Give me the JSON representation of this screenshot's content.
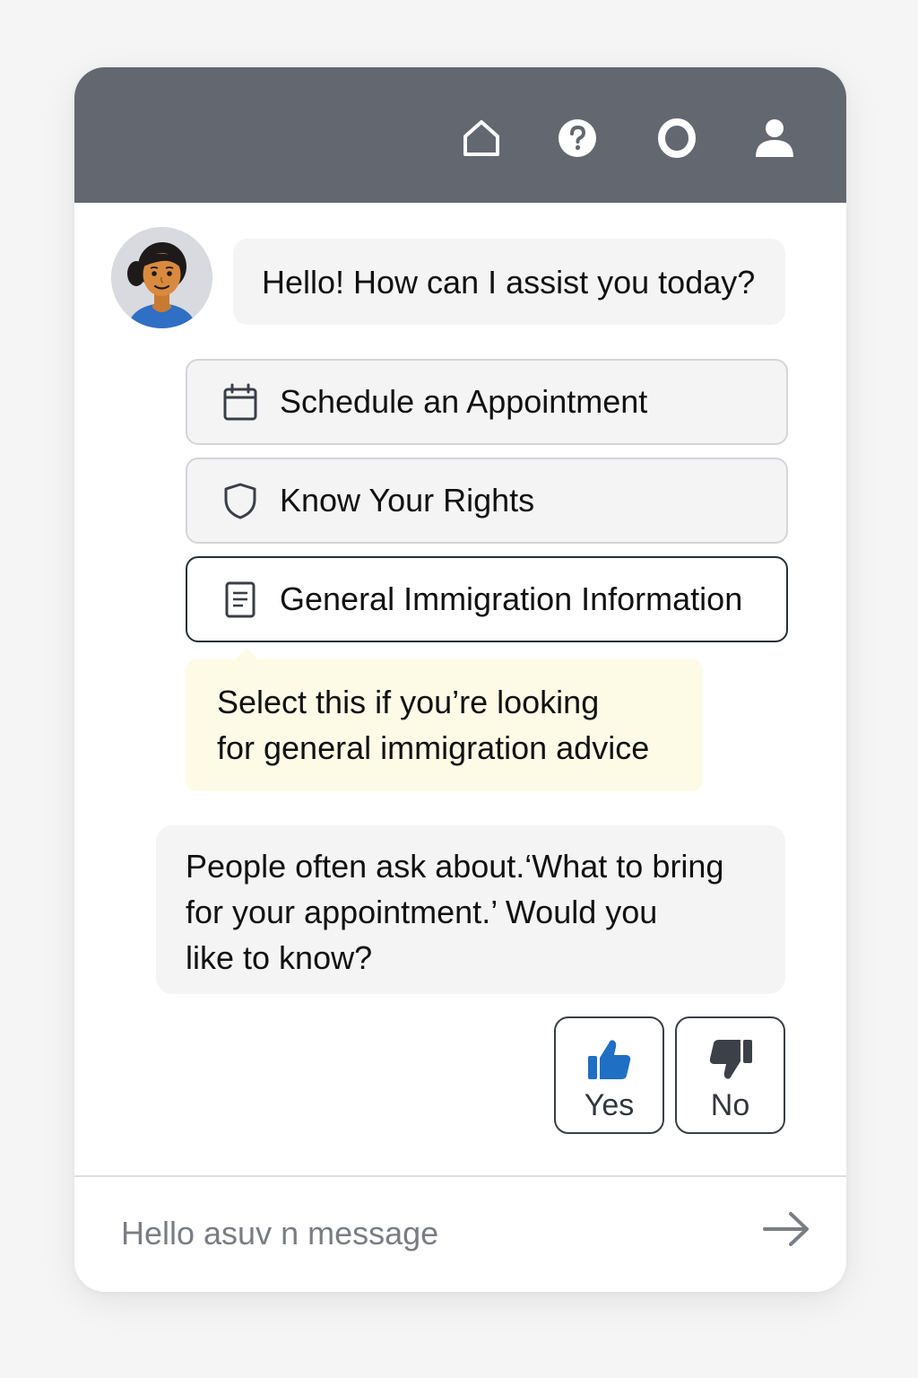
{
  "header": {
    "icons": [
      "home-icon",
      "help-icon",
      "circle-icon",
      "user-icon"
    ],
    "background_color": "#636770"
  },
  "chat": {
    "greeting": "Hello! How can I assist you today?",
    "options": [
      {
        "label": "Schedule an Appointment",
        "icon": "calendar-icon"
      },
      {
        "label": "Know Your Rights",
        "icon": "shield-icon"
      },
      {
        "label": "General Immigration Information",
        "icon": "document-icon",
        "selected": true
      }
    ],
    "tooltip": "Select this if you’re looking\nfor general immigration advice",
    "suggestion": "People often ask about.‘What to bring\nfor your appointment.’ Would you\nlike to know?",
    "feedback": {
      "yes_label": "Yes",
      "no_label": "No",
      "yes_icon": "thumbs-up-icon",
      "no_icon": "thumbs-down-icon",
      "yes_color": "#1f6fc5",
      "no_color": "#3c4048"
    }
  },
  "composer": {
    "placeholder": "Hello asuv n message",
    "send_icon": "arrow-right-icon"
  },
  "colors": {
    "tooltip_background": "#fdfbe6",
    "bubble_background": "#f4f4f5",
    "avatar_shirt": "#2f6fc4",
    "avatar_skin": "#d98a3e"
  }
}
